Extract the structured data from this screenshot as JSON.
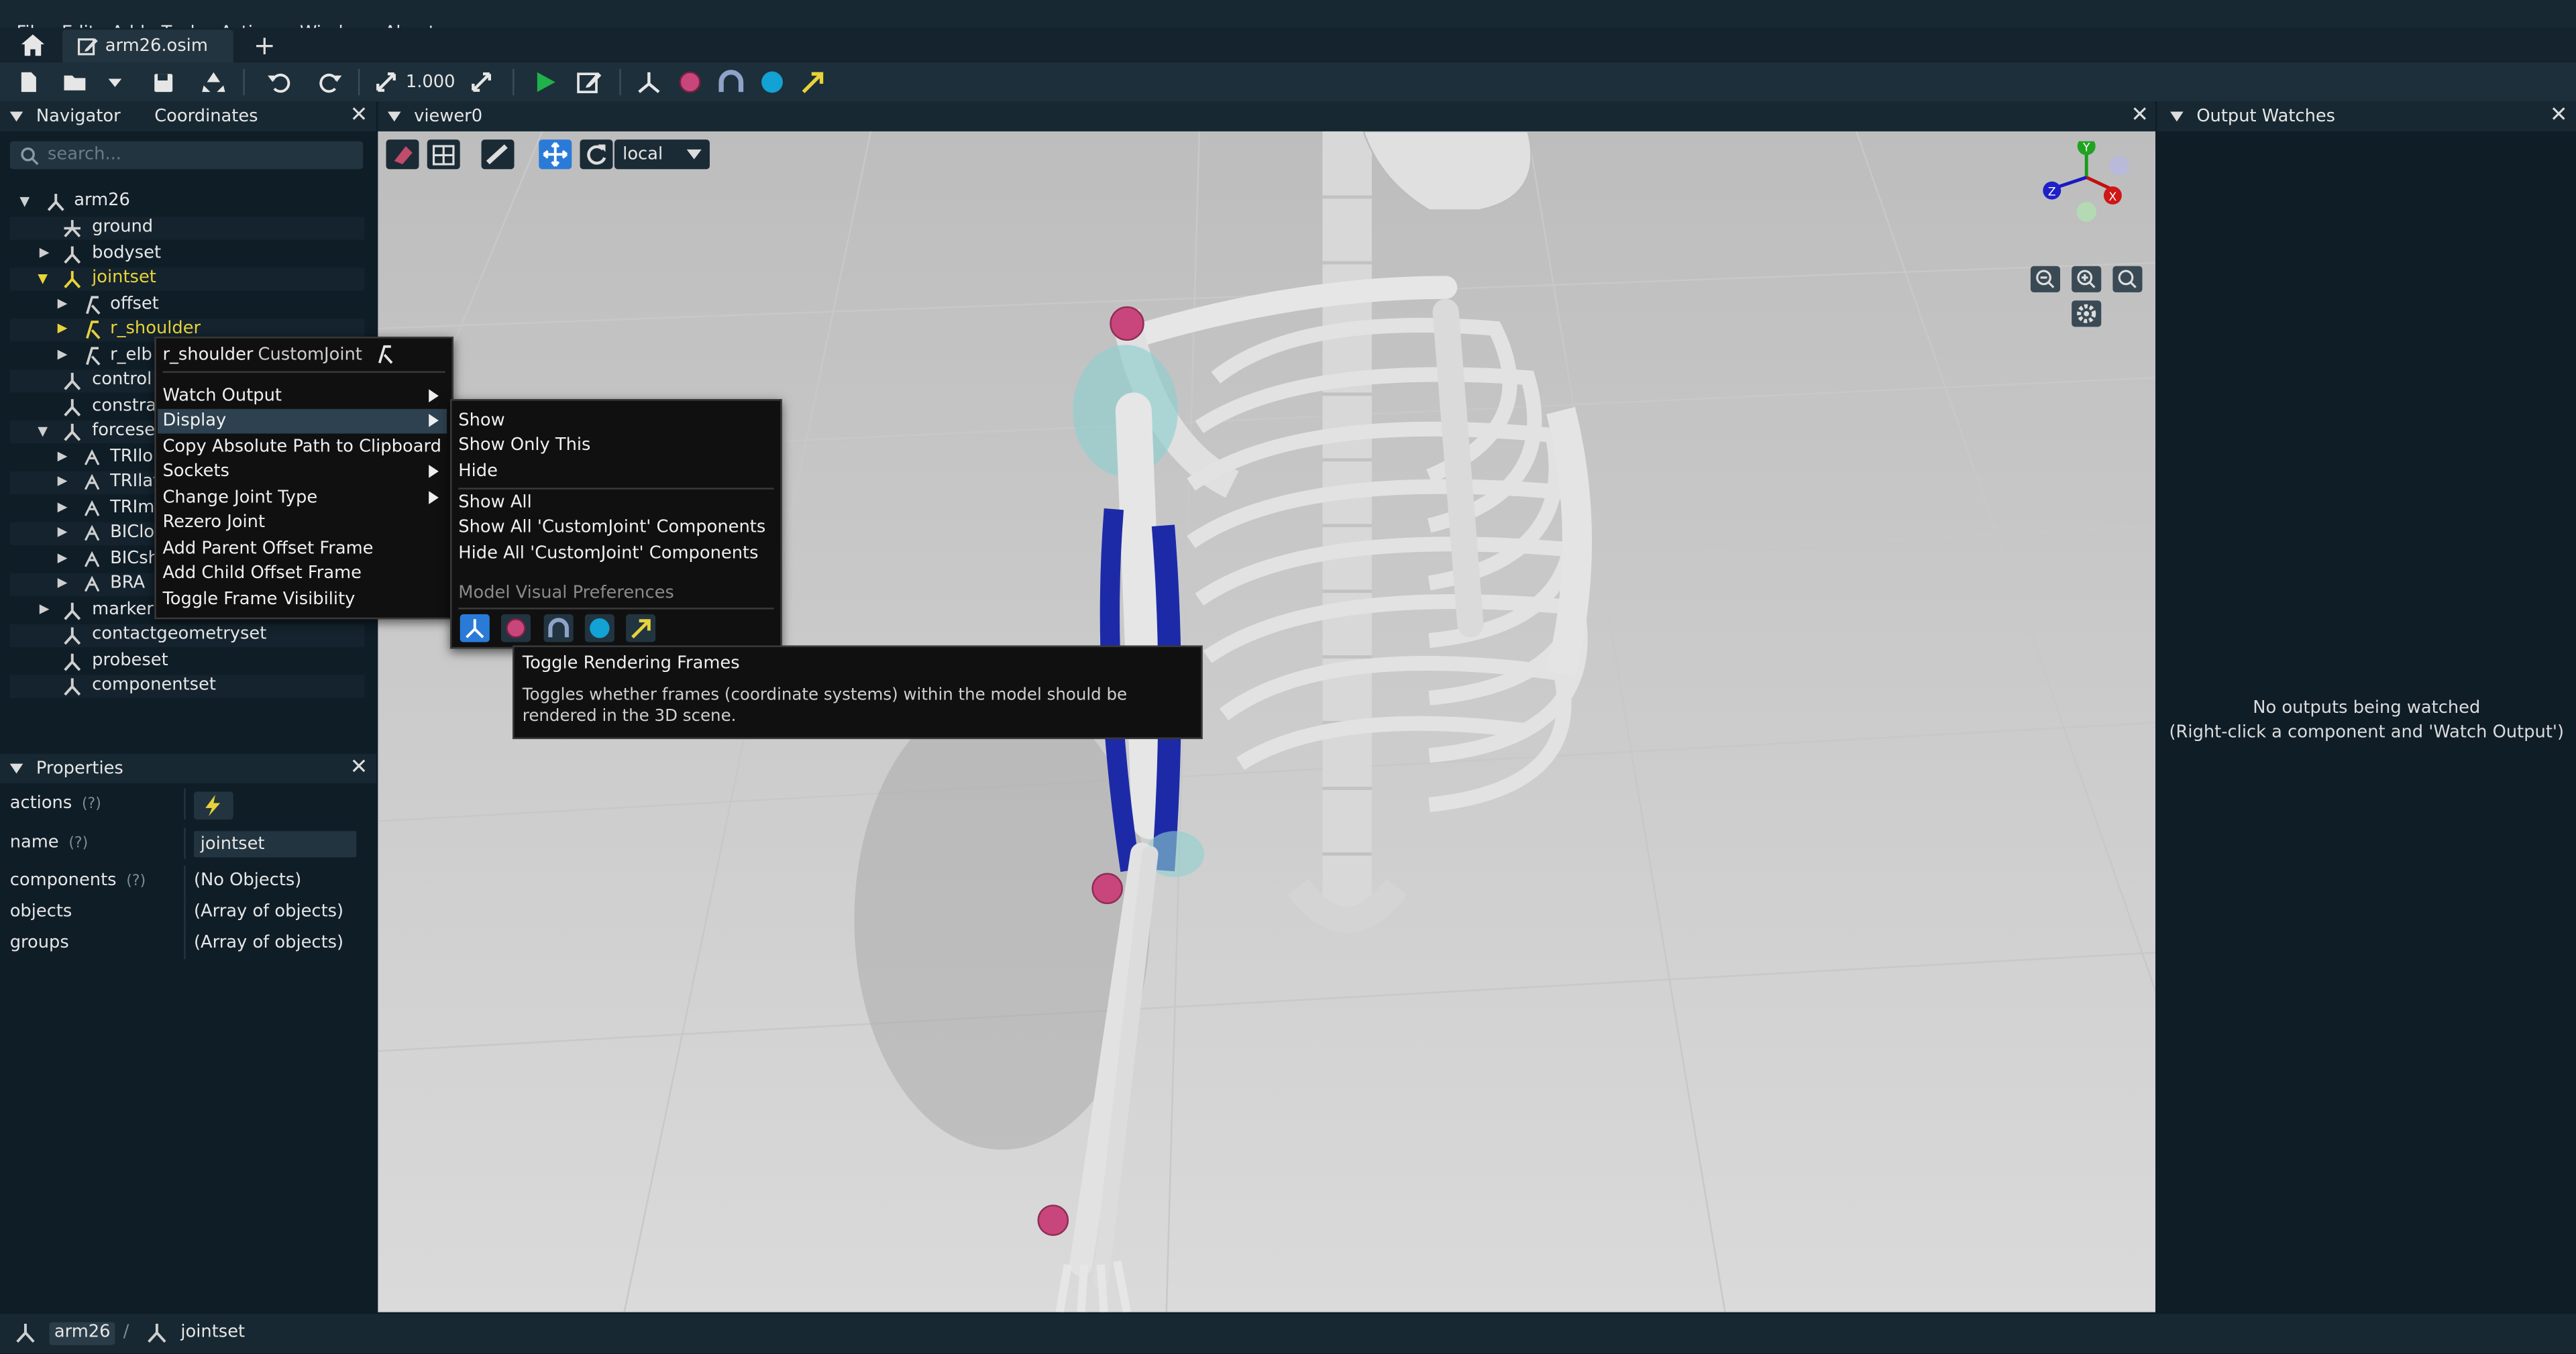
{
  "menubar": {
    "items": [
      "File",
      "Edit",
      "Add",
      "Tools",
      "Actions",
      "Window",
      "About"
    ]
  },
  "tabs": {
    "active_tab": "arm26.osim",
    "new_tab": "+"
  },
  "toolbar": {
    "scale_value": "1.000"
  },
  "navigator": {
    "title": "Navigator",
    "second_tab": "Coordinates",
    "search_placeholder": "search...",
    "tree": {
      "root": "arm26",
      "ground": "ground",
      "bodyset": "bodyset",
      "jointset": "jointset",
      "offset": "offset",
      "r_shoulder": "r_shoulder",
      "r_elbow": "r_elb",
      "controllerset": "control",
      "constraintset": "constra",
      "forceset": "forcese",
      "f1": "TRIlor",
      "f2": "TRIlat",
      "f3": "TRImed",
      "f4": "BIClo",
      "f5": "BICsh",
      "f6": "BRA",
      "markerset": "marker",
      "contactgeometryset": "contactgeometryset",
      "probeset": "probeset",
      "componentset": "componentset"
    }
  },
  "properties": {
    "title": "Properties",
    "help": "(?)",
    "rows": [
      {
        "key": "actions",
        "value": ""
      },
      {
        "key": "name",
        "value": "jointset"
      },
      {
        "key": "components",
        "value": "(No Objects)"
      },
      {
        "key": "objects",
        "value": "(Array of objects)"
      },
      {
        "key": "groups",
        "value": "(Array of objects)"
      }
    ]
  },
  "viewer": {
    "title": "viewer0",
    "frame_mode": "local",
    "gizmo_axes": {
      "y": "Y",
      "x": "X",
      "z": "Z"
    }
  },
  "context_menu": {
    "component_name": "r_shoulder",
    "component_type": "CustomJoint",
    "items": [
      "Watch Output",
      "Display",
      "Copy Absolute Path to Clipboard",
      "Sockets",
      "Change Joint Type",
      "Rezero Joint",
      "Add Parent Offset Frame",
      "Add Child Offset Frame",
      "Toggle Frame Visibility"
    ]
  },
  "display_submenu": {
    "items": [
      "Show",
      "Show Only This",
      "Hide"
    ],
    "items2": [
      "Show All",
      "Show All 'CustomJoint' Components",
      "Hide All 'CustomJoint' Components"
    ],
    "section_label": "Model Visual Preferences"
  },
  "tooltip": {
    "title": "Toggle Rendering Frames",
    "body": "Toggles whether frames (coordinate systems) within the model should be rendered in the 3D scene."
  },
  "output_watches": {
    "title": "Output Watches",
    "empty_line1": "No outputs being watched",
    "empty_line2": "(Right-click a component and 'Watch Output')"
  },
  "statusbar": {
    "crumbs": [
      "arm26",
      "jointset"
    ],
    "separator": "/"
  },
  "colors": {
    "background": "#0f1d27",
    "panel_header": "#172832",
    "selected_text": "#e8d23a",
    "highlight": "#2d4150",
    "accent_blue": "#2a7bd8",
    "marker_pink": "#c9467c",
    "muscle_blue": "#1d2aa8"
  }
}
